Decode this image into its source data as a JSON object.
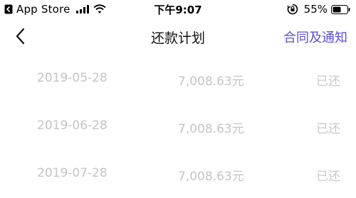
{
  "status_bar": {
    "carrier": "App Store",
    "time": "下午9:07",
    "battery": "55%"
  },
  "nav": {
    "title": "还款计划",
    "right_action": "合同及通知",
    "accent_color": "#5b4fd0"
  },
  "icons": {
    "back": "chevron-left",
    "signal": "signal-bars",
    "wifi": "wifi",
    "orientation_lock": "orientation-lock",
    "battery": "battery"
  },
  "schedule": [
    {
      "date": "2019-05-28",
      "amount": "7,008.63元",
      "status": "已还"
    },
    {
      "date": "2019-06-28",
      "amount": "7,008.63元",
      "status": "已还"
    },
    {
      "date": "2019-07-28",
      "amount": "7,008.63元",
      "status": "已还"
    }
  ]
}
